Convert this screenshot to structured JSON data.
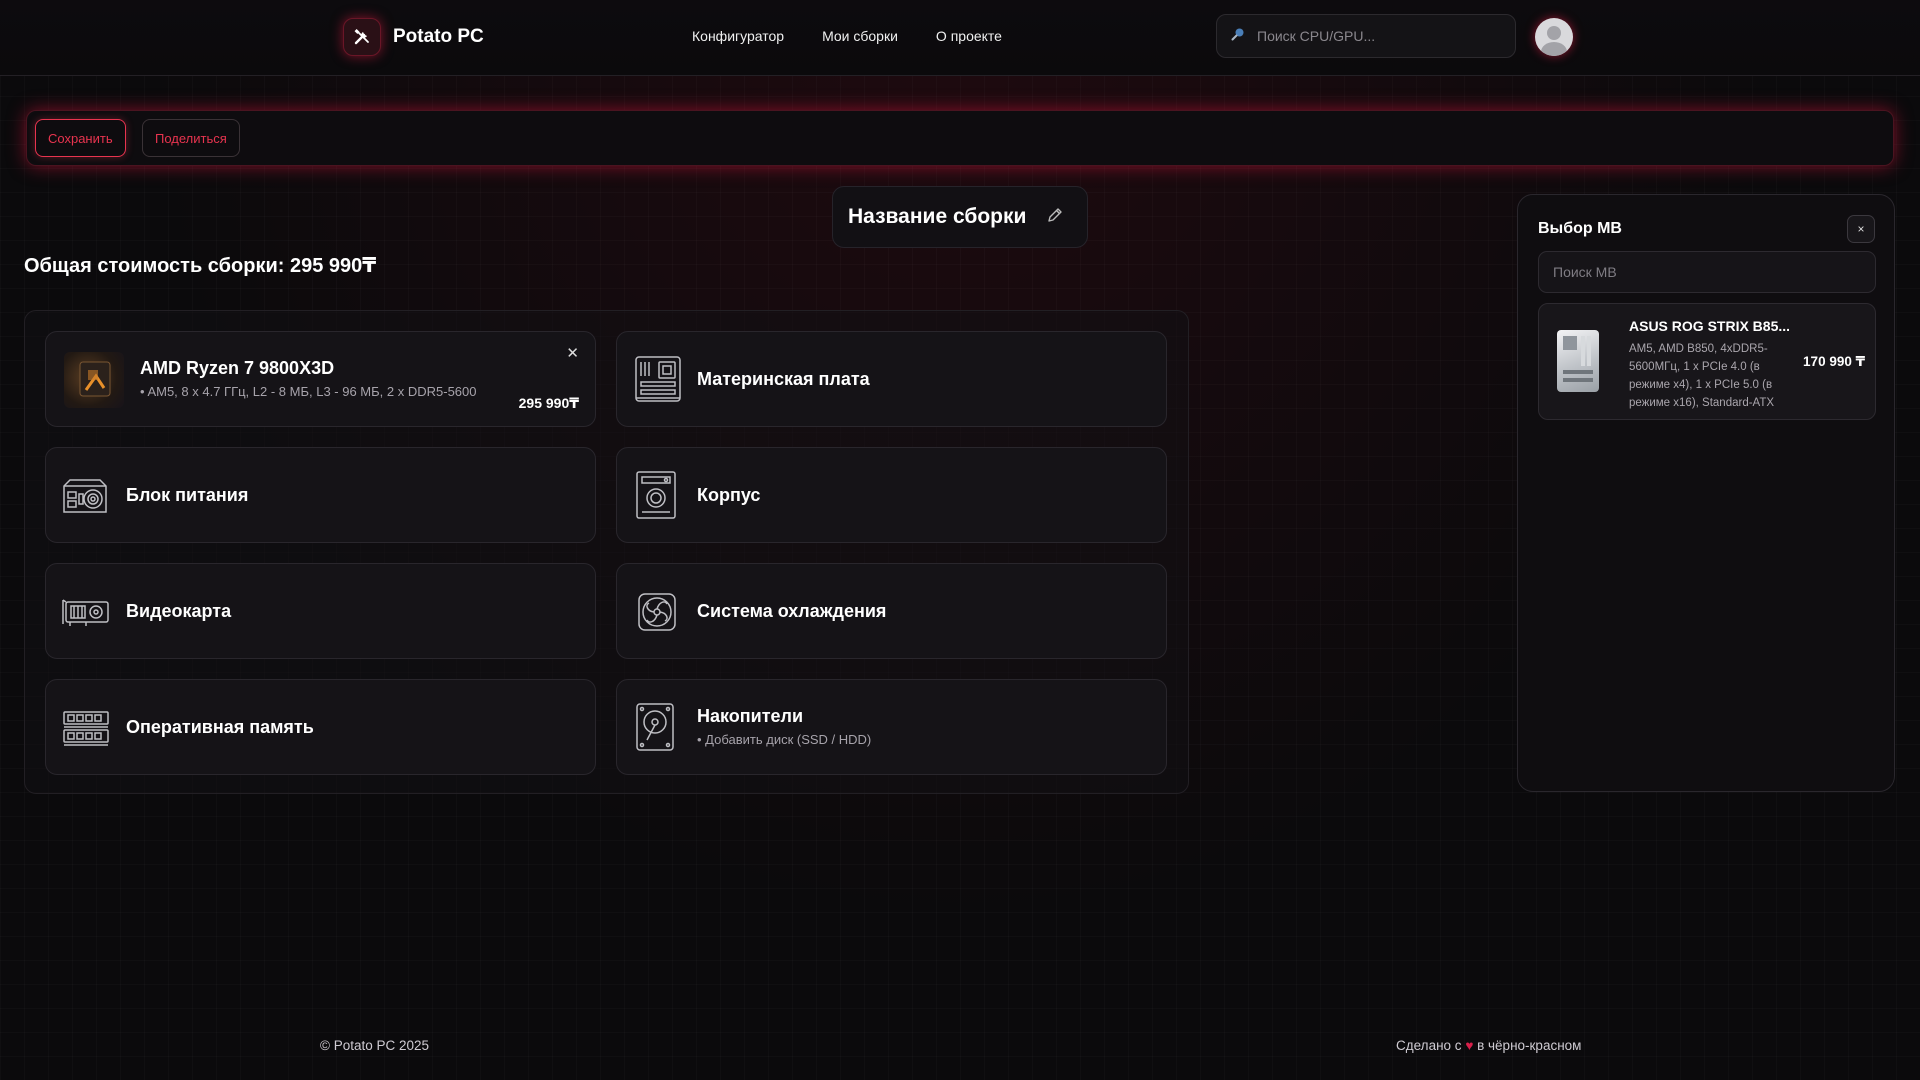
{
  "header": {
    "brand": "Potato PC",
    "nav": [
      "Конфигуратор",
      "Мои сборки",
      "О проекте"
    ],
    "search_placeholder": "Поиск CPU/GPU..."
  },
  "toolbar": {
    "save_label": "Сохранить",
    "share_label": "Поделиться"
  },
  "build": {
    "name": "Название сборки",
    "total": "Общая стоимость сборки: 295 990₸"
  },
  "components": {
    "cpu": {
      "name": "AMD Ryzen 7 9800X3D",
      "specs": "• AM5, 8 x 4.7 ГГц, L2 - 8 МБ, L3 - 96 МБ, 2 x DDR5-5600",
      "price": "295 990₸"
    },
    "motherboard": "Материнская плата",
    "psu": "Блок питания",
    "case": "Корпус",
    "gpu": "Видеокарта",
    "cooling": "Система охлаждения",
    "ram": "Оперативная память",
    "storage": {
      "label": "Накопители",
      "sub": "• Добавить диск (SSD / HDD)"
    }
  },
  "panel": {
    "title": "Выбор MB",
    "close": "×",
    "search_placeholder": "Поиск MB",
    "items": [
      {
        "name": "ASUS ROG STRIX B85...",
        "desc": "AM5, AMD B850, 4xDDR5-5600МГц, 1 x PCIe 4.0 (в режиме x4), 1 x PCIe 5.0 (в режиме x16), Standard-ATX",
        "price": "170 990 ₸"
      }
    ]
  },
  "footer": {
    "copyright": "© Potato PC 2025",
    "made_pre": "Сделано с",
    "made_post": "в чёрно-красном"
  },
  "colors": {
    "accent": "#e8344f",
    "background": "#0b0a0c",
    "card": "#151317"
  }
}
